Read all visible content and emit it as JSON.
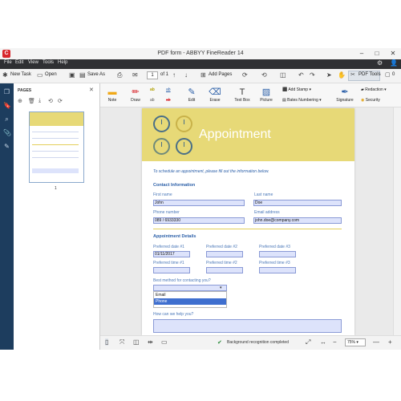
{
  "window": {
    "title": "PDF form - ABBYY FineReader 14",
    "logo": "C"
  },
  "menu": [
    "File",
    "Edit",
    "View",
    "Tools",
    "Help"
  ],
  "toolbar": {
    "new_task": "New Task",
    "open": "Open",
    "save_as": "Save As",
    "page_num": "1",
    "page_total": "of 1",
    "add_pages": "Add Pages",
    "pdf_tools": "PDF Tools",
    "comments_count": "0"
  },
  "pages_panel": {
    "title": "PAGES",
    "thumb_number": "1"
  },
  "ribbon": {
    "note": "Note",
    "draw": "Draw",
    "edit": "Edit",
    "erase": "Erase",
    "text_box": "Text Box",
    "picture": "Picture",
    "add_stamp": "Add Stamp",
    "bates": "Bates Numbering",
    "signature": "Signature",
    "redaction": "Redaction",
    "security": "Security"
  },
  "document": {
    "banner_title": "Appointment",
    "intro": "To schedule an appointment, please fill out the information below.",
    "contact_heading": "Contact Information",
    "first_name_label": "First name",
    "first_name_value": "John",
    "last_name_label": "Last name",
    "last_name_value": "Doe",
    "phone_label": "Phone number",
    "phone_value": "089 / 6933330",
    "email_label": "Email address",
    "email_value": "john.doe@company.com",
    "appt_heading": "Appointment Details",
    "pref_date1_label": "Preferred date #1",
    "pref_date1_value": "01/11/2017",
    "pref_date2_label": "Preferred date #2",
    "pref_date3_label": "Preferred date #3",
    "pref_time1_label": "Preferred time #1",
    "pref_time2_label": "Preferred time #2",
    "pref_time3_label": "Preferred time #3",
    "best_method_label": "Best method for contacting you?",
    "dropdown_options": [
      "Email",
      "Phone"
    ],
    "help_label": "How can we help you?"
  },
  "status": {
    "text": "Background recognition completed",
    "zoom": "75%"
  },
  "colors": {
    "banner": "#e7d977",
    "menubar": "#2f3033",
    "leftstrip": "#1d3d5e",
    "field": "#dde3fb",
    "selected_option": "#3f6fcf"
  }
}
